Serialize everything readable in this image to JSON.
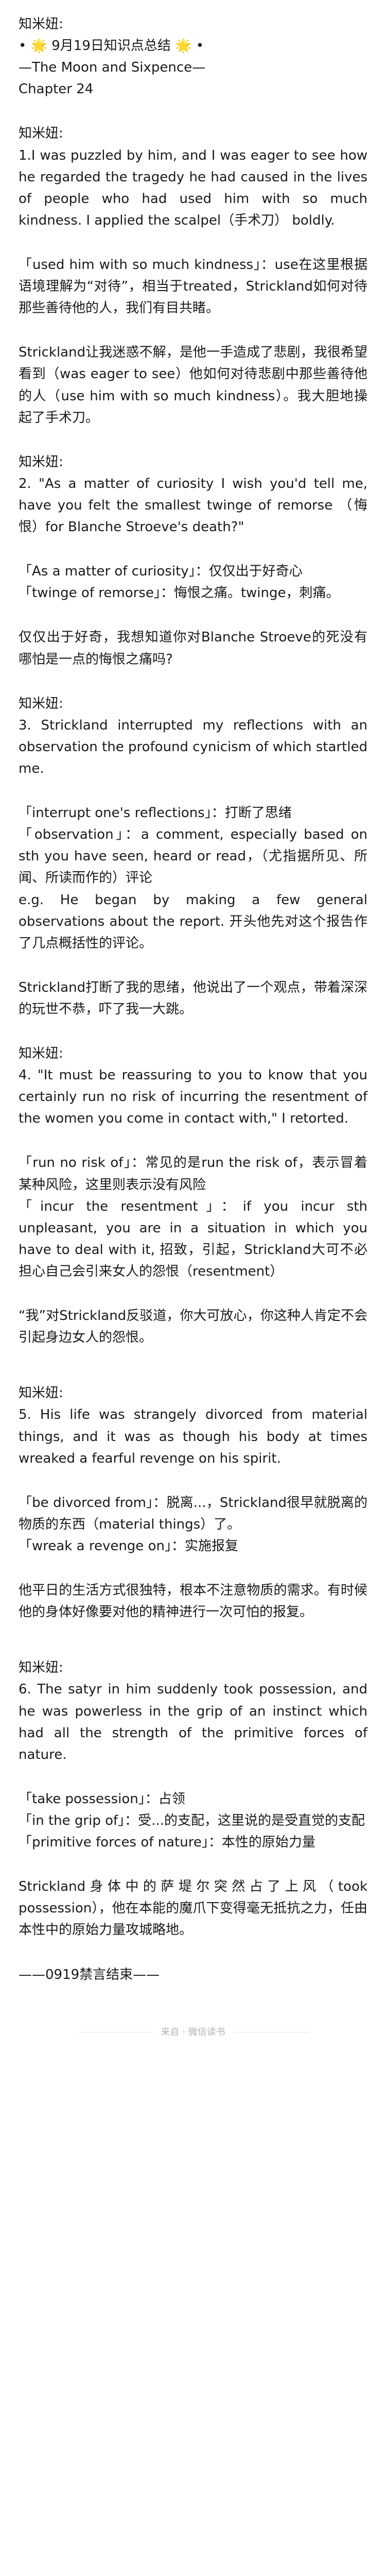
{
  "header": {
    "author": "知米妞:",
    "title": "• 🌟 9月19日知识点总结 🌟 •",
    "subtitle": "—The Moon and Sixpence—",
    "chapter": "Chapter 24"
  },
  "sections": [
    {
      "author": "知米妞:",
      "paragraphs": [
        "1.I was puzzled by him, and I was eager to see how he regarded the tragedy he had caused in the lives of people who had used him with so much kindness. I applied the scalpel（手术刀） boldly.",
        "「used him with so much kindness」：use在这里根据语境理解为“对待”，相当于treated，Strickland如何对待那些善待他的人，我们有目共睹。",
        "Strickland让我迷惑不解，是他一手造成了悲剧，我很希望看到（was eager to see）他如何对待悲剧中那些善待他的人（use him with so much kindness）。我大胆地操起了手术刀。"
      ]
    },
    {
      "author": "知米妞:",
      "paragraphs": [
        "2. \"As a matter of curiosity I wish you'd tell me, have you felt the smallest twinge of remorse （悔恨）for Blanche Stroeve's death?\"",
        "「As a matter of curiosity」：仅仅出于好奇心\n「twinge of remorse」：悔恨之痛。twinge，刺痛。",
        "仅仅出于好奇，我想知道你对Blanche Stroeve的死没有哪怕是一点的悔恨之痛吗?"
      ]
    },
    {
      "author": "知米妞:",
      "paragraphs": [
        "3. Strickland interrupted my reflections with an observation the profound cynicism of which startled me.",
        "「interrupt one's reflections」：打断了思绪\n「observation」：a comment, especially based on sth you have seen, heard or read，（尤指据所见、所闻、所读而作的）评论\ne.g. He began by making a few general observations about the report. 开头他先对这个报告作了几点概括性的评论。",
        "Strickland打断了我的思绪，他说出了一个观点，带着深深的玩世不恭，吓了我一大跳。"
      ]
    },
    {
      "author": "知米妞:",
      "paragraphs": [
        "4. \"It must be reassuring to you to know that you certainly run no risk of incurring the resentment of the women you come in contact with,\" I retorted.",
        "「run no risk of」：常见的是run the risk of，表示冒着某种风险，这里则表示没有风险\n「incur the resentment」：if you incur sth unpleasant, you are in a situation in which you have to deal with it, 招致，引起，Strickland大可不必担心自己会引来女人的怨恨（resentment）",
        "“我”对Strickland反驳道，你大可放心，你这种人肯定不会引起身边女人的怨恨。"
      ]
    },
    {
      "author": "知米妞:",
      "paragraphs": [
        "5. His life was strangely divorced from material things, and it was as though his body at times wreaked a fearful revenge on his spirit.",
        "「be divorced from」：脱离...，Strickland很早就脱离的物质的东西（material things）了。\n「wreak a revenge on」：实施报复",
        "他平日的生活方式很独特，根本不注意物质的需求。有时候他的身体好像要对他的精神进行一次可怕的报复。"
      ]
    },
    {
      "author": "知米妞:",
      "paragraphs": [
        "6. The satyr in him suddenly took possession, and he was powerless in the grip of an instinct which had all the strength of the primitive forces of nature.",
        "「take possession」：占领\n「in the grip of」：受...的支配，这里说的是受直觉的支配\n「primitive forces of nature」：本性的原始力量",
        "Strickland身体中的萨堤尔突然占了上风（took possession），他在本能的魔爪下变得毫无抵抗之力，任由本性中的原始力量攻城略地。"
      ]
    }
  ],
  "ending": "——0919禁言结束——",
  "footer": {
    "label": "来自 · 微信读书"
  }
}
